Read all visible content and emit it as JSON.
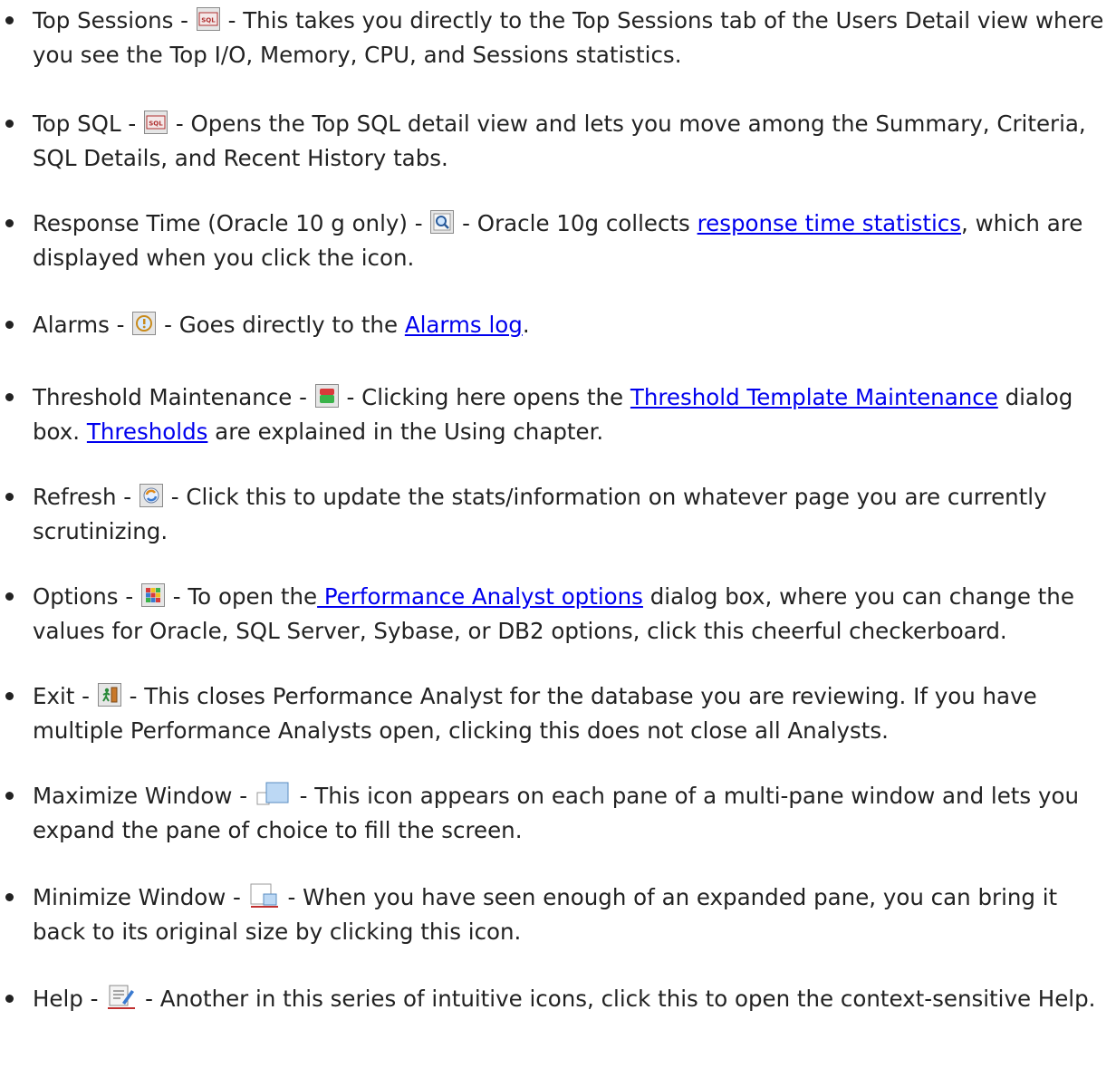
{
  "items": [
    {
      "name": "Top Sessions",
      "pre": "Top Sessions - ",
      "post": " - This takes you directly to the Top Sessions tab of the Users Detail view where you see the Top I/O, Memory, CPU, and Sessions statistics.",
      "icon": "sql-icon"
    },
    {
      "name": "Top SQL",
      "pre": "Top SQL - ",
      "post": " - Opens the Top SQL detail view and lets you move among the Summary, Criteria, SQL Details, and Recent History tabs.",
      "icon": "sql-icon"
    },
    {
      "name": "Response Time",
      "pre": "Response Time (Oracle 10 g only) - ",
      "mid": " - Oracle 10g collects ",
      "link": "response time statistics",
      "post": ", which are displayed when you click the icon.",
      "icon": "magnifier-icon"
    },
    {
      "name": "Alarms",
      "pre": "Alarms - ",
      "mid": " - Goes directly to the ",
      "link": "Alarms log",
      "post": ".",
      "icon": "alarm-icon"
    },
    {
      "name": "Threshold Maintenance",
      "pre": "Threshold Maintenance - ",
      "mid": " - Clicking here opens the ",
      "link": "Threshold Template Maintenance",
      "mid2": " dialog box. ",
      "link2": "Thresholds",
      "post": " are explained in the Using chapter.",
      "icon": "threshold-icon"
    },
    {
      "name": "Refresh",
      "pre": "Refresh - ",
      "post": " - Click this to update the stats/information on whatever page you are currently scrutinizing.",
      "icon": "refresh-icon"
    },
    {
      "name": "Options",
      "pre": "Options - ",
      "mid": " - To open the",
      "link": " Performance Analyst options",
      "post": " dialog box, where you can change the values for Oracle, SQL Server, Sybase, or DB2 options, click this cheerful checkerboard.",
      "icon": "checkerboard-icon"
    },
    {
      "name": "Exit",
      "pre": "Exit - ",
      "post": " - This closes Performance Analyst for the database you are reviewing. If you have multiple Performance Analysts open, clicking this does not close all Analysts.",
      "icon": "exit-icon"
    },
    {
      "name": "Maximize Window",
      "pre": "Maximize Window - ",
      "post": " - This icon appears on each pane of a multi-pane window and lets you expand the pane of choice to fill the screen.",
      "icon": "maximize-icon"
    },
    {
      "name": "Minimize Window",
      "pre": "Minimize Window - ",
      "post": " - When you have seen enough of an expanded pane, you can bring it back to its original size by clicking this icon.",
      "icon": "minimize-icon"
    },
    {
      "name": "Help",
      "pre": "Help - ",
      "post": " - Another in this series of intuitive icons, click this to open the context-sensitive Help.",
      "icon": "help-icon"
    }
  ],
  "colors": {
    "text": "#222222",
    "link": "#0000ee"
  }
}
